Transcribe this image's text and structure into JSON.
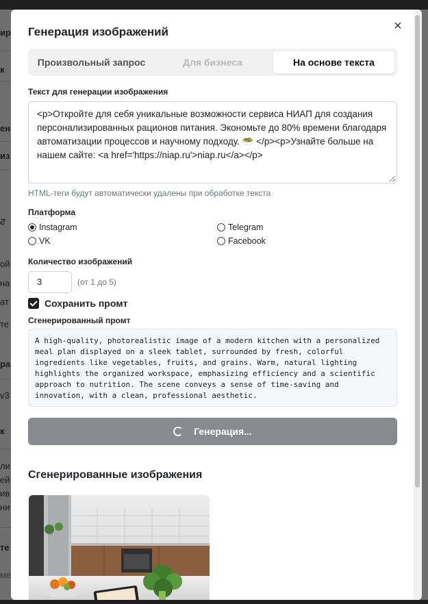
{
  "background_fragments": [
    "ир",
    "к",
    "ен",
    "из",
    "г",
    "ой",
    "на",
    "ат",
    "те",
    "ра",
    "v3",
    "к",
    "ли",
    "ей",
    "ив",
    "ни",
    "те",
    "ме"
  ],
  "modal": {
    "title": "Генерация изображений",
    "close_icon": "close-icon",
    "tabs": [
      {
        "label": "Произвольный запрос",
        "state": "inactive"
      },
      {
        "label": "Для бизнеса",
        "state": "disabled"
      },
      {
        "label": "На основе текста",
        "state": "active"
      }
    ],
    "source_text": {
      "label": "Текст для генерации изображения",
      "value": "<p>Откройте для себя уникальные возможности сервиса НИАП для создания персонализированных рационов питания. Экономьте до 80% времени благодаря автоматизации процессов и научному подходу. 🥗 </p><p>Узнайте больше на нашем сайте: <a href='https://niap.ru'>niap.ru</a></p>",
      "help": "HTML-теги будут автоматически удалены при обработке текста"
    },
    "platform": {
      "label": "Платформа",
      "options": [
        {
          "label": "Instagram",
          "checked": true
        },
        {
          "label": "Telegram",
          "checked": false
        },
        {
          "label": "VK",
          "checked": false
        },
        {
          "label": "Facebook",
          "checked": false
        }
      ]
    },
    "count": {
      "label": "Количество изображений",
      "value": "3",
      "hint": "(от 1 до 5)"
    },
    "save_prompt": {
      "label": "Сохранить промт",
      "checked": true
    },
    "generated_prompt": {
      "label": "Сгенерированный промт",
      "value": "A high-quality, photorealistic image of a modern kitchen with a personalized\nmeal plan displayed on a sleek tablet, surrounded by fresh, colorful\ningredients like vegetables, fruits, and grains. Warm, natural lighting\nhighlights the organized workspace, emphasizing efficiency and a scientific\napproach to nutrition. The scene conveys a sense of time-saving and\ninnovation, with a clean, professional aesthetic."
    },
    "generate_button": {
      "label": "Генерация...",
      "icon": "spinner-icon",
      "loading": true
    },
    "results": {
      "title": "Сгенерированные изображения"
    }
  },
  "colors": {
    "button_disabled": "#878a8e",
    "overlay": "#6e6e6e",
    "checkbox": "#1f1f1f"
  }
}
